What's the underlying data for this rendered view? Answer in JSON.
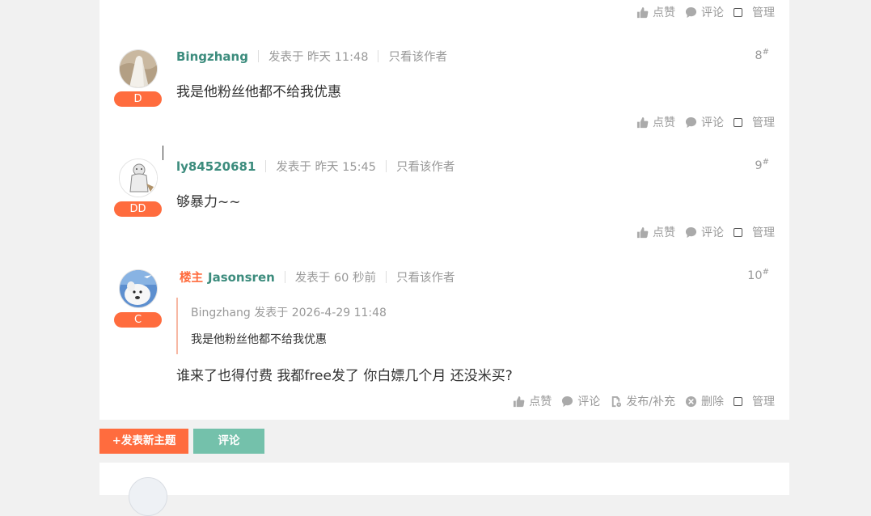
{
  "actions": {
    "like": "点赞",
    "comment": "评论",
    "manage": "管理",
    "publish": "发布/补充",
    "delete": "删除"
  },
  "posts": [
    {
      "author": "Bingzhang",
      "time": "发表于 昨天 11:48",
      "only_author": "只看该作者",
      "floor": "8",
      "floor_mark": "#",
      "badge": "D",
      "content": "我是他粉丝他都不给我优惠"
    },
    {
      "author": "ly84520681",
      "time": "发表于 昨天 15:45",
      "only_author": "只看该作者",
      "floor": "9",
      "floor_mark": "#",
      "badge": "DD",
      "content": "够暴力~~"
    },
    {
      "owner_tag": "楼主",
      "author": "Jasonsren",
      "time": "发表于 60 秒前",
      "only_author": "只看该作者",
      "floor": "10",
      "floor_mark": "#",
      "badge": "C",
      "quote_header": "Bingzhang 发表于 2026-4-29 11:48",
      "quote_text": "我是他粉丝他都不给我优惠",
      "content": "谁来了也得付费 我都free发了 你白嫖几个月 还没米买?"
    }
  ],
  "buttons": {
    "new_topic": "+发表新主题",
    "comment": "评论"
  },
  "colors": {
    "accent": "#ff6c3e",
    "author": "#3c8c7d",
    "comment_button": "#74c1ab"
  }
}
